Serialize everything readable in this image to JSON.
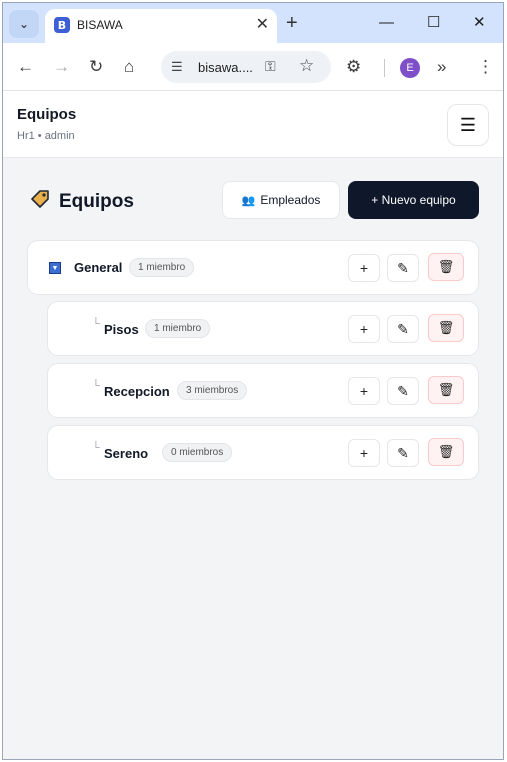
{
  "browser": {
    "tab_title": "BISAWA",
    "favicon_letter": "B",
    "url": "bisawa....",
    "profile_initial": "E"
  },
  "header": {
    "title": "Equipos",
    "subtitle": "Hr1 • admin"
  },
  "page": {
    "title": "Equipos",
    "employees_button": "Empleados",
    "new_team_button": "+ Nuevo equipo"
  },
  "teams": [
    {
      "name": "General",
      "members": "1 miembro"
    },
    {
      "name": "Pisos",
      "members": "1 miembro"
    },
    {
      "name": "Recepcion",
      "members": "3 miembros"
    },
    {
      "name": "Sereno",
      "members": "0 miembros"
    }
  ],
  "actions": {
    "add": "+"
  },
  "colors": {
    "primary": "#0f172a",
    "danger_bg": "#fef2f2",
    "accent": "#3b6fd1"
  }
}
